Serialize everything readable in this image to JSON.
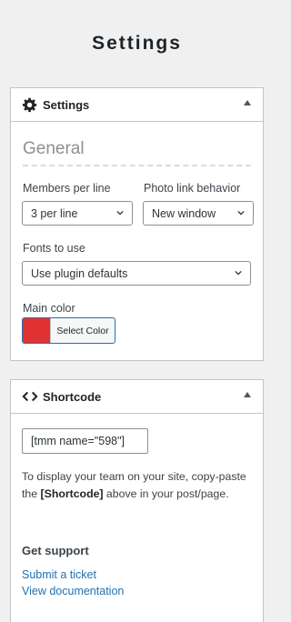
{
  "page": {
    "title": "Settings"
  },
  "settings_panel": {
    "title": "Settings",
    "icon": "gear-icon",
    "section_title": "General",
    "members_per_line": {
      "label": "Members per line",
      "value": "3 per line"
    },
    "photo_link_behavior": {
      "label": "Photo link behavior",
      "value": "New window"
    },
    "fonts_to_use": {
      "label": "Fonts to use",
      "value": "Use plugin defaults"
    },
    "main_color": {
      "label": "Main color",
      "button_label": "Select Color",
      "color": "#e03232"
    }
  },
  "shortcode_panel": {
    "title": "Shortcode",
    "icon": "code-icon",
    "shortcode": "[tmm name=\"598\"]",
    "description_before": "To display your team on your site, copy-paste the ",
    "description_bold": "[Shortcode]",
    "description_after": " above in your post/page.",
    "support_title": "Get support",
    "links": [
      "Submit a ticket",
      "View documentation"
    ]
  },
  "colors": {
    "link": "#2271b1",
    "accent_red": "#e03232",
    "background": "#f0f0f1"
  }
}
